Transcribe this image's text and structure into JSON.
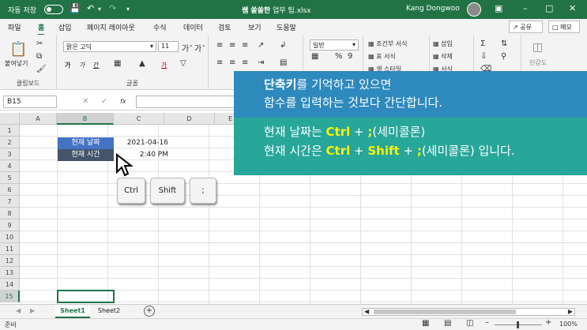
{
  "titlebar": {
    "autosave_label": "자동 저장",
    "autosave_state": "끔",
    "file_title_bold": "쌤 쏠쏠한",
    "file_title_rest": "업무 팁.xlsx",
    "user_name": "Kang Dongwoo",
    "window_buttons": [
      "ribbon-display-icon",
      "minimize-icon",
      "restore-icon",
      "close-icon"
    ],
    "accent_color": "#217346"
  },
  "menu": {
    "items": [
      "파일",
      "홈",
      "삽입",
      "페이지 레이아웃",
      "수식",
      "데이터",
      "검토",
      "보기",
      "도움말"
    ],
    "active": "홈",
    "share_label": "공유",
    "memo_label": "메모"
  },
  "ribbon": {
    "paste_label": "붙여넣기",
    "clipboard_label": "클립보드",
    "font_name": "맑은 고딕",
    "font_size": "11",
    "font_group_label": "글꼴",
    "number_format": "일반",
    "cond_format_label": "조건부 서식",
    "table_format_label": "표 서식",
    "cell_style_label": "셀 스타일",
    "insert_label": "삽입",
    "delete_label": "삭제",
    "format_label": "서식",
    "sensitivity_label": "민감도"
  },
  "formula_bar": {
    "name_box": "B15",
    "fx_label": "fx",
    "cancel_icon": "x-icon",
    "confirm_icon": "check-icon"
  },
  "grid": {
    "columns": [
      "A",
      "B",
      "C",
      "D",
      "E"
    ],
    "selected_column": "B",
    "rows": [
      "1",
      "2",
      "3",
      "4",
      "5",
      "6",
      "7",
      "8",
      "9",
      "10",
      "11",
      "12",
      "13",
      "14",
      "15"
    ],
    "selected_row": "15",
    "b2": "현재 날짜",
    "b3": "현재 시간",
    "c2": "2021-04-16",
    "c3": "2:40 PM"
  },
  "keys": [
    "Ctrl",
    "Shift",
    ";"
  ],
  "banner": {
    "line1_bold": "단축키",
    "line1_rest": "를 기억하고 있으면",
    "line2": "함수를 입력하는 것보다 간단합니다.",
    "line3_a": "현재 날짜는 ",
    "line3_ctrl": "Ctrl",
    "line3_plus": " + ",
    "line3_semi": ";",
    "line3_b": "(세미콜론)",
    "line4_a": "현재 시간은 ",
    "line4_ctrl": "Ctrl",
    "line4_plus1": " + ",
    "line4_shift": "Shift",
    "line4_plus2": " + ",
    "line4_semi": ";",
    "line4_b": "(세미콜론) 입니다.",
    "color_top": "#2e89bd",
    "color_bottom": "#27a69a",
    "highlight_color": "#fff200"
  },
  "sheets": {
    "tabs": [
      "Sheet1",
      "Sheet2"
    ],
    "active": "Sheet1",
    "add_icon": "plus-icon"
  },
  "status": {
    "ready": "준비",
    "zoom": "100%"
  }
}
